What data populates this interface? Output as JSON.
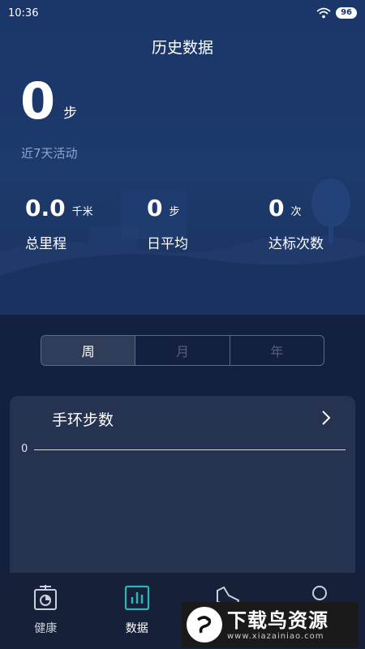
{
  "status_bar": {
    "time": "10:36",
    "battery": "96"
  },
  "header": {
    "title": "历史数据"
  },
  "summary": {
    "steps": "0",
    "steps_unit": "步",
    "subtitle": "近7天活动"
  },
  "stats": [
    {
      "value": "0.0",
      "unit": "千米",
      "label": "总里程"
    },
    {
      "value": "0",
      "unit": "步",
      "label": "日平均"
    },
    {
      "value": "0",
      "unit": "次",
      "label": "达标次数"
    }
  ],
  "period_tabs": [
    "周",
    "月",
    "年"
  ],
  "selected_period": "周",
  "card": {
    "title": "手环步数",
    "axis_zero": "0"
  },
  "bottom_nav": [
    {
      "label": "健康",
      "icon": "scale-icon"
    },
    {
      "label": "数据",
      "icon": "bar-chart-icon"
    },
    {
      "label": "",
      "icon": "shoe-icon"
    },
    {
      "label": "",
      "icon": "person-icon"
    }
  ],
  "watermark": {
    "title": "下载鸟资源",
    "url": "www.xiazainiao.com"
  },
  "colors": {
    "hero": "#1b3668",
    "background": "#14203f",
    "card": "#253250",
    "accent": "#2fb5b8"
  }
}
